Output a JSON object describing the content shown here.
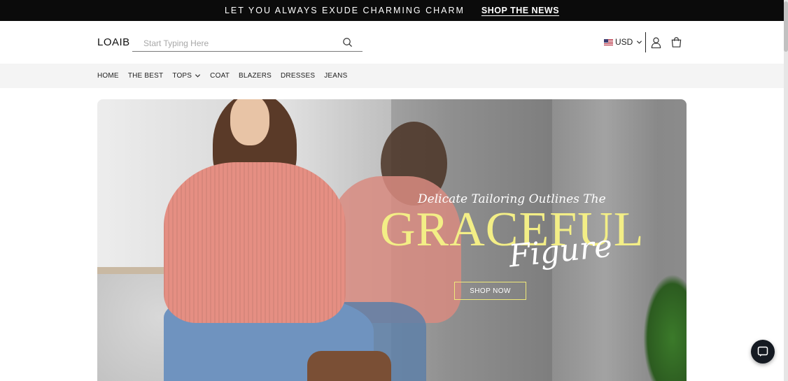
{
  "announcement": {
    "message": "LET YOU ALWAYS EXUDE CHARMING CHARM",
    "link": "SHOP THE NEWS"
  },
  "header": {
    "logo": "LOAIB",
    "search": {
      "placeholder": "Start Typing Here",
      "value": ""
    },
    "currency": {
      "label": "USD",
      "flag": "us-flag-icon"
    },
    "icons": [
      "search-icon",
      "user-icon",
      "shopping-bag-icon",
      "chevron-down-icon"
    ]
  },
  "nav": {
    "items": [
      {
        "label": "HOME"
      },
      {
        "label": "THE BEST"
      },
      {
        "label": "TOPS",
        "has_dropdown": true
      },
      {
        "label": "COAT"
      },
      {
        "label": "BLAZERS"
      },
      {
        "label": "DRESSES"
      },
      {
        "label": "JEANS"
      }
    ]
  },
  "hero": {
    "tagline": "Delicate Tailoring Outlines The",
    "headline": "GRACEFUL",
    "script": "Figure",
    "cta": "SHOP NOW",
    "colors": {
      "headline": "#f3ee86",
      "cta_border": "#f0e97a"
    }
  },
  "chat": {
    "icon": "chat-bubble-icon"
  }
}
